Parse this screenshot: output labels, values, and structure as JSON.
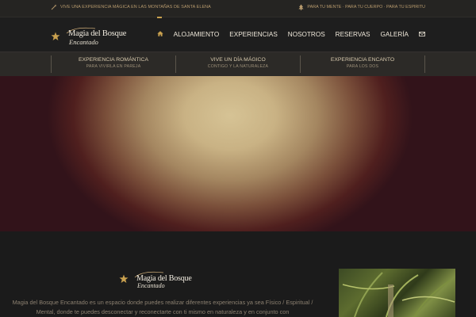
{
  "topbar": {
    "left_text": "VIVE UNA EXPERIENCIA MÁGICA EN LAS MONTAÑAS DE SANTA ELENA",
    "left_icon": "wand-icon",
    "right_text": "PARA TU MENTE · PARA TU CUERPO · PARA TU ESPIRITU",
    "right_icon": "tree-icon"
  },
  "logo": {
    "line1": "Magia del Bosque",
    "line2": "Encantado"
  },
  "nav": {
    "home_icon": "home-icon",
    "items": [
      "ALOJAMIENTO",
      "EXPERIENCIAS",
      "NOSOTROS",
      "RESERVAS",
      "GALERÍA"
    ],
    "mail_icon": "mail-icon"
  },
  "subnav": [
    {
      "title": "EXPERIENCIA ROMÁNTICA",
      "subtitle": "PARA VIVIRLA EN PAREJA"
    },
    {
      "title": "VIVE UN DÍA MÁGICO",
      "subtitle": "CONTIGO Y LA NATURALEZA"
    },
    {
      "title": "EXPERIENCIA ENCANTO",
      "subtitle": "PARA LOS DOS"
    }
  ],
  "content": {
    "paragraph": "Magia del Bosque Encantado es un espacio donde puedes realizar diferentes experiencias ya sea Físico / Espiritual / Mental, donde te puedes desconectar y reconectarte con ti mismo en naturaleza y en conjunto con"
  },
  "colors": {
    "accent": "#c9a14f",
    "background": "#1b1b1b"
  }
}
